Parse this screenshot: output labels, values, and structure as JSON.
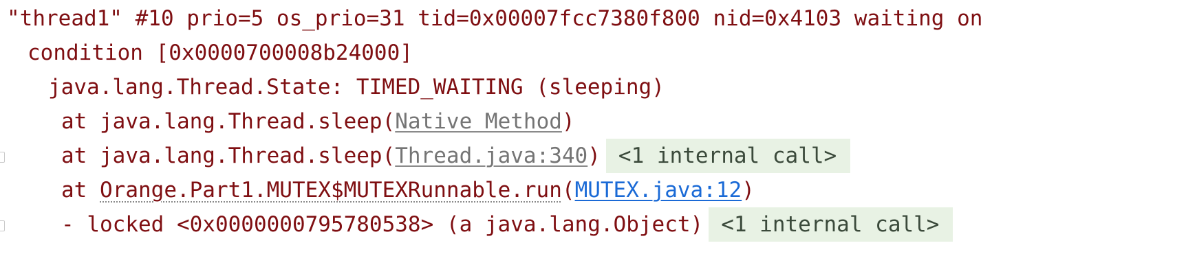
{
  "thread_dump": {
    "header": {
      "line1": "\"thread1\" #10 prio=5 os_prio=31 tid=0x00007fcc7380f800 nid=0x4103 waiting on",
      "line2": "condition [0x0000700008b24000]"
    },
    "state": "java.lang.Thread.State: TIMED_WAITING (sleeping)",
    "frames": [
      {
        "prefix": "at java.lang.Thread.sleep(",
        "source": "Native Method",
        "suffix": ")"
      },
      {
        "prefix": "at java.lang.Thread.sleep(",
        "source": "Thread.java:340",
        "suffix": ")",
        "folded": "<1 internal call>"
      },
      {
        "at": "at ",
        "method": "Orange.Part1.MUTEX$MUTEXRunnable.run",
        "open": "(",
        "source": "MUTEX.java:12",
        "suffix": ")"
      }
    ],
    "lock": {
      "text": "- locked <0x0000000795780538> (a java.lang.Object)",
      "folded": "<1 internal call>"
    }
  },
  "colors": {
    "text": "#7f0f12",
    "source_link": "#757575",
    "project_link": "#1a6ad6",
    "fold_background": "#e8f2e4"
  }
}
